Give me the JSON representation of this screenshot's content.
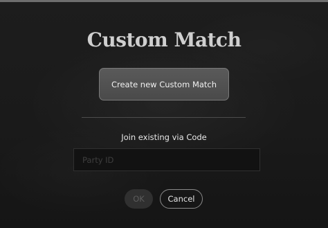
{
  "dialog": {
    "title": "Custom Match",
    "create_button_label": "Create new Custom Match",
    "join_label": "Join existing via Code",
    "party_id_input": {
      "value": "",
      "placeholder": "Party ID"
    },
    "ok_label": "OK",
    "cancel_label": "Cancel"
  },
  "colors": {
    "background": "#1a1a1a",
    "title_text": "#cfcfcf",
    "button_fill": "#525252",
    "ok_disabled": "#303030"
  }
}
